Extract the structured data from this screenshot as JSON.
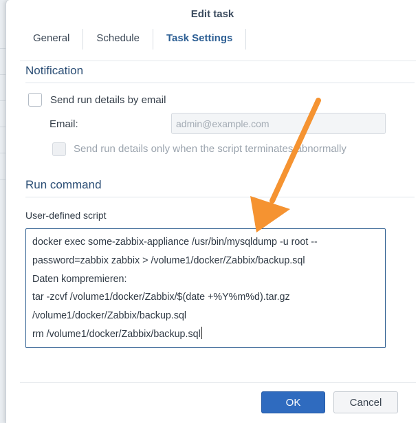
{
  "dialog": {
    "title": "Edit task",
    "tabs": [
      {
        "label": "General",
        "active": false
      },
      {
        "label": "Schedule",
        "active": false
      },
      {
        "label": "Task Settings",
        "active": true
      }
    ]
  },
  "notification": {
    "section_title": "Notification",
    "send_email_label": "Send run details by email",
    "send_email_checked": false,
    "email_label": "Email:",
    "email_placeholder": "admin@example.com",
    "email_value": "",
    "abnormal_only_label": "Send run details only when the script terminates abnormally",
    "abnormal_only_checked": false
  },
  "run_command": {
    "section_title": "Run command",
    "script_label": "User-defined script",
    "script_lines": [
      "docker exec some-zabbix-appliance /usr/bin/mysqldump -u root --",
      "password=zabbix zabbix > /volume1/docker/Zabbix/backup.sql",
      "Daten kompremieren:",
      "tar -zcvf /volume1/docker/Zabbix/$(date +%Y%m%d).tar.gz",
      "/volume1/docker/Zabbix/backup.sql",
      "rm /volume1/docker/Zabbix/backup.sql"
    ]
  },
  "footer": {
    "ok_label": "OK",
    "cancel_label": "Cancel"
  },
  "colors": {
    "accent": "#2f6bbf",
    "section_title": "#2b4e75",
    "annotation_arrow": "#f59331"
  },
  "icons": {
    "annotation": "arrow-annotation-icon"
  }
}
